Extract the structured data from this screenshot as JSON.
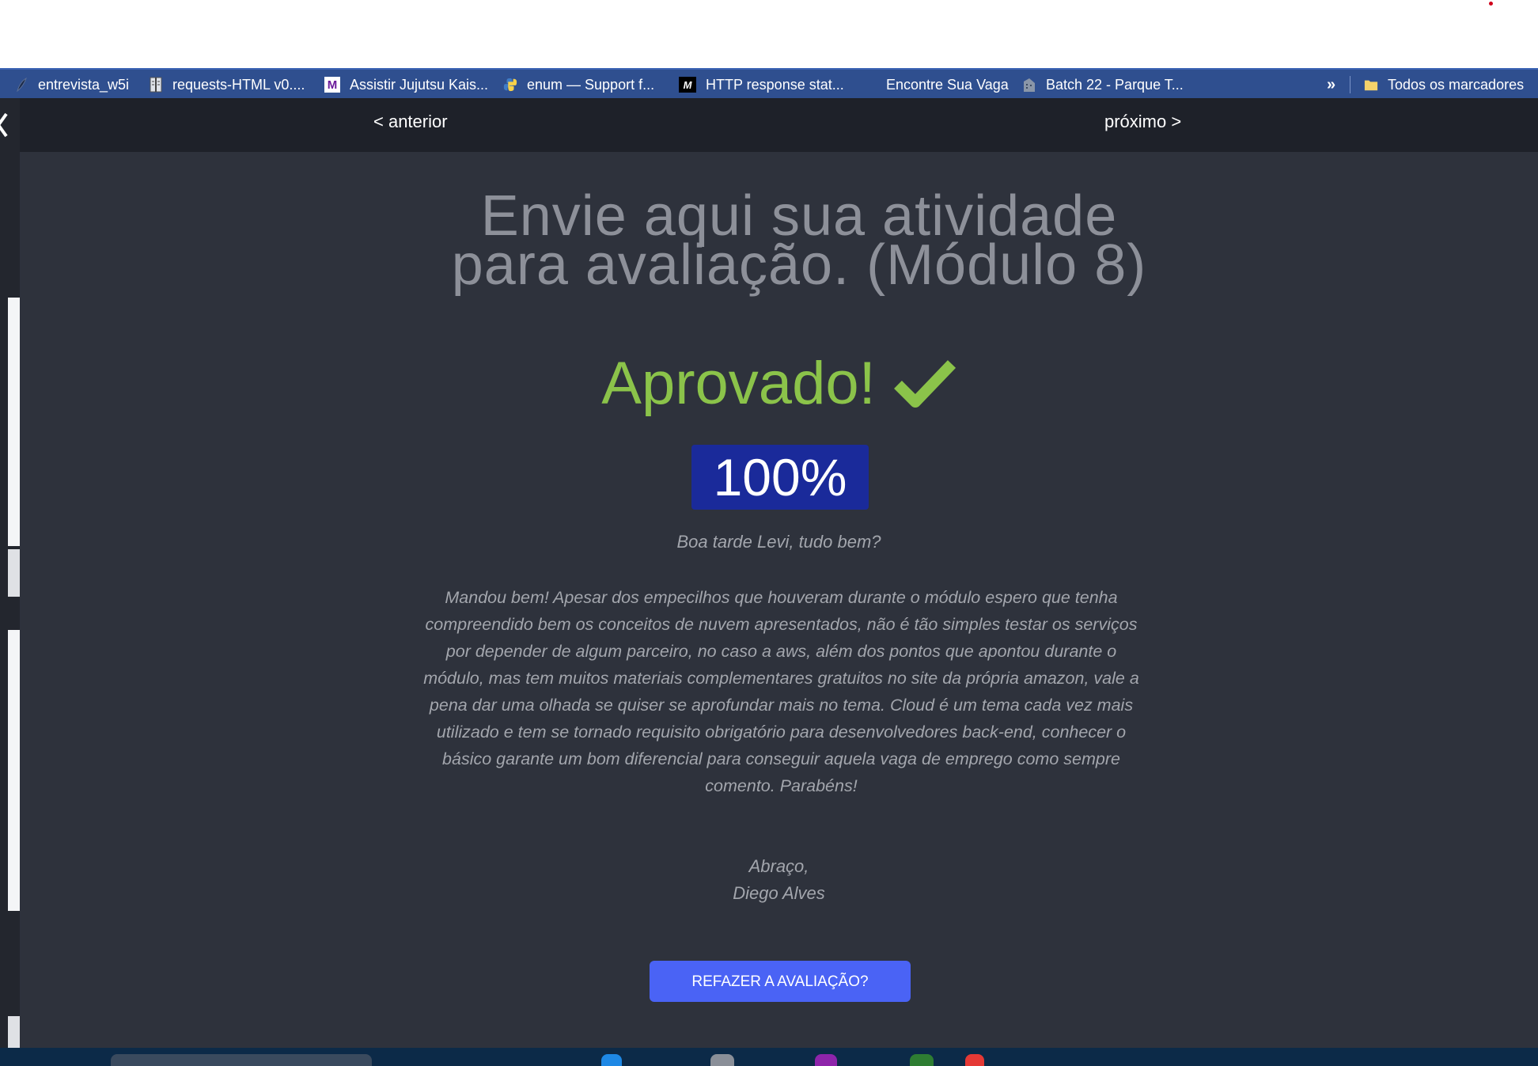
{
  "bookmarks": {
    "items": [
      {
        "label": "entrevista_w5i",
        "icon": "feather-icon"
      },
      {
        "label": "requests-HTML v0....",
        "icon": "document-icon"
      },
      {
        "label": "Assistir Jujutsu Kais...",
        "icon": "m-logo-icon"
      },
      {
        "label": "enum — Support f...",
        "icon": "python-icon"
      },
      {
        "label": "HTTP response stat...",
        "icon": "mdn-icon"
      },
      {
        "label": "Encontre Sua Vaga",
        "icon": ""
      },
      {
        "label": "Batch 22 - Parque T...",
        "icon": "building-icon"
      }
    ],
    "overflow": "»",
    "all_bookmarks": "Todos os marcadores"
  },
  "nav": {
    "previous": "< anterior",
    "next": "próximo >"
  },
  "content": {
    "title": "Envie aqui sua atividade para avaliação. (Módulo 8)",
    "status": "Aprovado!",
    "score": "100%",
    "greeting": "Boa tarde Levi, tudo bem?",
    "feedback": "Mandou bem! Apesar dos empecilhos que houveram durante o módulo espero que tenha compreendido bem os conceitos de nuvem apresentados, não é tão simples testar os serviços por depender de algum parceiro, no caso a aws, além dos pontos que apontou durante o módulo, mas tem muitos materiais complementares gratuitos no site da própria amazon, vale a pena dar uma olhada se quiser se aprofundar mais no tema. Cloud é um tema cada vez mais utilizado e tem se tornado requisito obrigatório para desenvolvedores back-end, conhecer o básico garante um bom diferencial para conseguir aquela vaga de emprego como sempre comento. Parabéns!",
    "closing": "Abraço,",
    "author": "Diego Alves",
    "redo_button": "REFAZER A AVALIAÇÃO?"
  },
  "colors": {
    "approved": "#8bc34a",
    "score_bg": "#1a2a9a",
    "button_bg": "#4a63f5",
    "background": "#2e323c"
  }
}
